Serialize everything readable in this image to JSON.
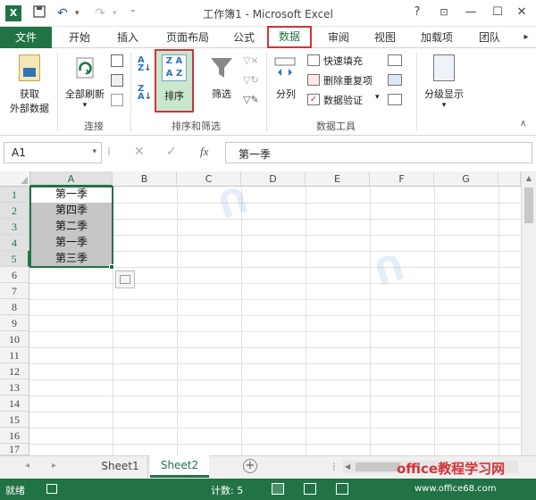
{
  "window": {
    "title": "工作簿1 - Microsoft Excel",
    "help": "?",
    "minimize": "—",
    "maximize": "☐",
    "close": "✕"
  },
  "tabs": [
    {
      "label": "文件"
    },
    {
      "label": "开始"
    },
    {
      "label": "插入"
    },
    {
      "label": "页面布局"
    },
    {
      "label": "公式"
    },
    {
      "label": "数据"
    },
    {
      "label": "审阅"
    },
    {
      "label": "视图"
    },
    {
      "label": "加载项"
    },
    {
      "label": "团队"
    }
  ],
  "ribbon": {
    "get_external": "获取",
    "get_external2": "外部数据",
    "refresh_all": "全部刷新",
    "group_connections": "连接",
    "sort": "排序",
    "filter": "筛选",
    "group_sort_filter": "排序和筛选",
    "split": "分列",
    "flash_fill": "快速填充",
    "remove_dup": "删除重复项",
    "validation": "数据验证",
    "group_data_tools": "数据工具",
    "outline": "分级显示"
  },
  "formula_bar": {
    "name_box": "A1",
    "fx": "fx",
    "content": "第一季"
  },
  "columns": [
    "A",
    "B",
    "C",
    "D",
    "E",
    "F",
    "G"
  ],
  "rows": [
    "1",
    "2",
    "3",
    "4",
    "5",
    "6",
    "7",
    "8",
    "9",
    "10",
    "11",
    "12",
    "13",
    "14",
    "15",
    "16",
    "17"
  ],
  "cells": [
    "第一季",
    "第四季",
    "第二季",
    "第一季",
    "第三季"
  ],
  "sheets": [
    "Sheet1",
    "Sheet2"
  ],
  "status": {
    "ready": "就绪",
    "count": "计数: 5"
  },
  "watermark": {
    "brand": "office教程学习网",
    "url": "www.office68.com"
  },
  "colors": {
    "excel_green": "#217346",
    "highlight_red": "#d13438",
    "selection_gray": "#c6c6c6"
  }
}
